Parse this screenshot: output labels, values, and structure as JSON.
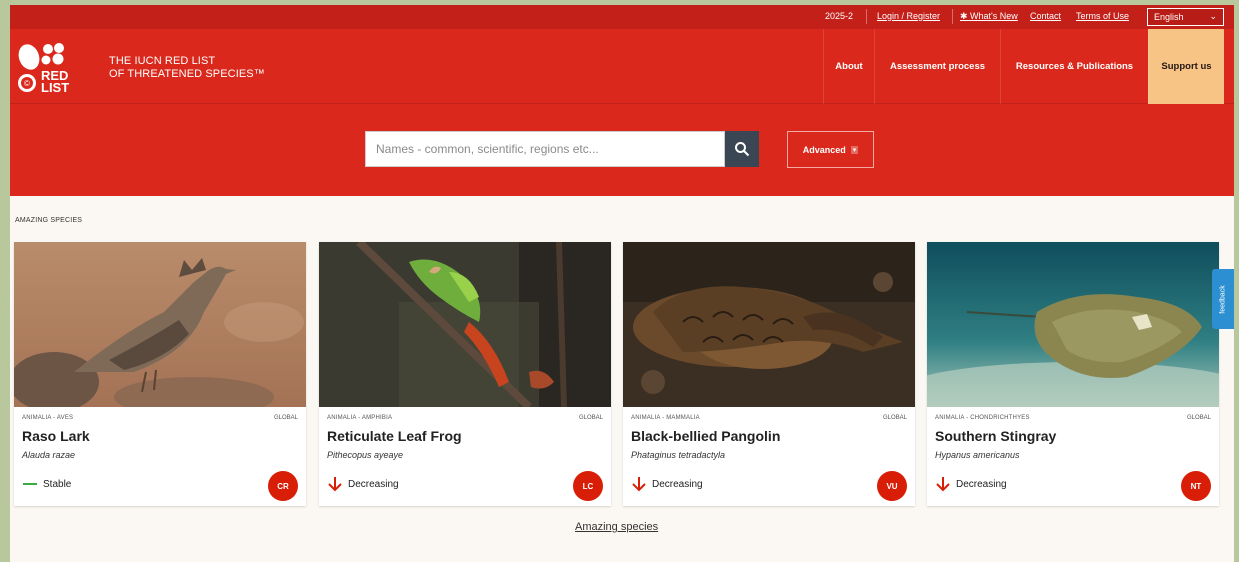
{
  "utility": {
    "version": "2025-2",
    "login": "Login / Register",
    "whats_new": "What's New",
    "contact": "Contact",
    "terms": "Terms of Use",
    "language": "English"
  },
  "brand": {
    "logo_text_1": "RED",
    "logo_text_2": "LIST",
    "line1": "THE IUCN RED LIST",
    "line2": "OF THREATENED SPECIES™"
  },
  "nav": {
    "about": "About",
    "assessment": "Assessment process",
    "resources": "Resources & Publications",
    "support": "Support us"
  },
  "search": {
    "placeholder": "Names - common, scientific, regions etc...",
    "advanced": "Advanced"
  },
  "section_label": "AMAZING SPECIES",
  "cards": [
    {
      "taxonomy": "ANIMALIA - AVES",
      "scope": "GLOBAL",
      "name": "Raso Lark",
      "scientific": "Alauda razae",
      "trend": "Stable",
      "trend_type": "stable",
      "status": "CR"
    },
    {
      "taxonomy": "ANIMALIA - AMPHIBIA",
      "scope": "GLOBAL",
      "name": "Reticulate Leaf Frog",
      "scientific": "Pithecopus ayeaye",
      "trend": "Decreasing",
      "trend_type": "decreasing",
      "status": "LC"
    },
    {
      "taxonomy": "ANIMALIA - MAMMALIA",
      "scope": "GLOBAL",
      "name": "Black-bellied Pangolin",
      "scientific": "Phataginus tetradactyla",
      "trend": "Decreasing",
      "trend_type": "decreasing",
      "status": "VU"
    },
    {
      "taxonomy": "ANIMALIA - CHONDRICHTHYES",
      "scope": "GLOBAL",
      "name": "Southern Stingray",
      "scientific": "Hypanus americanus",
      "trend": "Decreasing",
      "trend_type": "decreasing",
      "status": "NT"
    }
  ],
  "feedback": "feedback",
  "bottom_link": "Amazing species",
  "colors": {
    "brand_red": "#da291c",
    "dark_red": "#c4201a",
    "support_bg": "#f8c486",
    "search_btn": "#3a4654",
    "badge": "#d81e06",
    "stable": "#3aa845",
    "decreasing": "#d81e06"
  }
}
